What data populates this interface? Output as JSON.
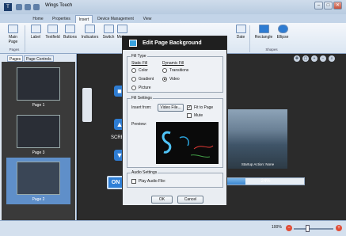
{
  "app": {
    "title": "Wings Touch"
  },
  "window_controls": {
    "minimize": "–",
    "maximize": "□",
    "close": "✕"
  },
  "tabs": [
    "Home",
    "Properties",
    "Insert",
    "Device Management",
    "View"
  ],
  "active_tab": "Insert",
  "ribbon": {
    "items": [
      "Main Page",
      "Label",
      "Textfield",
      "Buttons",
      "Indicators",
      "Switch",
      "Meter",
      "Date",
      "Rectangle",
      "Ellipse"
    ],
    "groups": [
      "Pages",
      "Shapes"
    ]
  },
  "left_panel": {
    "tabs": [
      "Pages",
      "Page Controls"
    ],
    "pages": [
      "Page 1",
      "Page 3",
      "Page 2"
    ],
    "selected_page": "Page 2"
  },
  "canvas": {
    "screen_text": "SCRE",
    "on_label": "ON",
    "photo_caption": "Startup Action: None",
    "progress_label": "24%",
    "progress_value": 0.24
  },
  "statusbar": {
    "zoom": "100%"
  },
  "dialog": {
    "title": "Edit Page Background",
    "fill_type_legend": "Fill Type",
    "static_fill_label": "Static Fill",
    "dynamic_fill_label": "Dynamic Fill",
    "options_static": [
      "Color",
      "Gradient",
      "Picture"
    ],
    "options_dynamic": [
      "Transitions",
      "Video"
    ],
    "selected_option": "Video",
    "fill_settings_legend": "Fill Settings",
    "insert_from_label": "Insert from:",
    "video_file_button": "Video File...",
    "fit_to_page_label": "Fit to Page",
    "fit_to_page_checked": true,
    "mute_label": "Mute",
    "mute_checked": false,
    "preview_label": "Preview:",
    "audio_legend": "Audio Settings",
    "play_audio_label": "Play Audio File:",
    "play_audio_checked": false,
    "ok_button": "OK",
    "cancel_button": "Cancel"
  },
  "colors": {
    "accent": "#2e7cd2",
    "selected_page": "#5f8fc9",
    "dialog_title": "#1f1f1f"
  }
}
